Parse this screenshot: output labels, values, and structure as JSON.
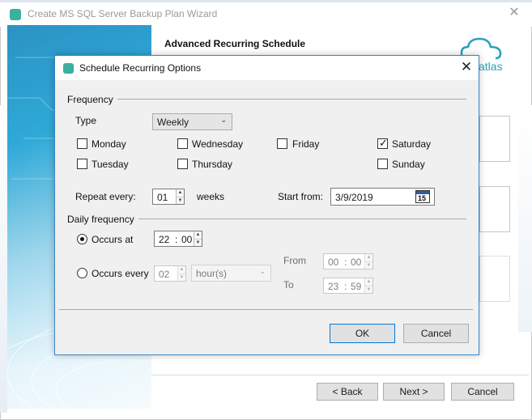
{
  "wizard": {
    "title": "Create MS SQL Server Backup Plan Wizard",
    "header": "Advanced Recurring Schedule",
    "logo_text": "atlas",
    "buttons": {
      "back": "< Back",
      "next": "Next >",
      "cancel": "Cancel"
    }
  },
  "dialog": {
    "title": "Schedule Recurring Options",
    "frequency": {
      "group_label": "Frequency",
      "type_label": "Type",
      "type_value": "Weekly",
      "days": [
        {
          "label": "Monday",
          "checked": false
        },
        {
          "label": "Wednesday",
          "checked": false
        },
        {
          "label": "Friday",
          "checked": false
        },
        {
          "label": "Saturday",
          "checked": true
        },
        {
          "label": "Tuesday",
          "checked": false
        },
        {
          "label": "Thursday",
          "checked": false
        },
        {
          "label": "Sunday",
          "checked": false
        }
      ],
      "repeat_label": "Repeat every:",
      "repeat_value": "01",
      "repeat_unit": "weeks",
      "start_label": "Start from:",
      "start_value": "3/9/2019",
      "calendar_day": "15"
    },
    "daily": {
      "group_label": "Daily frequency",
      "occurs_at_label": "Occurs at",
      "occurs_at_hour": "22",
      "occurs_at_minute": "00",
      "occurs_every_label": "Occurs every",
      "occurs_every_value": "02",
      "occurs_every_unit": "hour(s)",
      "from_label": "From",
      "from_hour": "00",
      "from_minute": "00",
      "to_label": "To",
      "to_hour": "23",
      "to_minute": "59",
      "selected": "occurs_at"
    },
    "buttons": {
      "ok": "OK",
      "cancel": "Cancel"
    }
  },
  "colors": {
    "accent_border": "#3b84c4",
    "brand_teal": "#3ab0a0",
    "sidebar_blue": "#2fa9d7"
  }
}
